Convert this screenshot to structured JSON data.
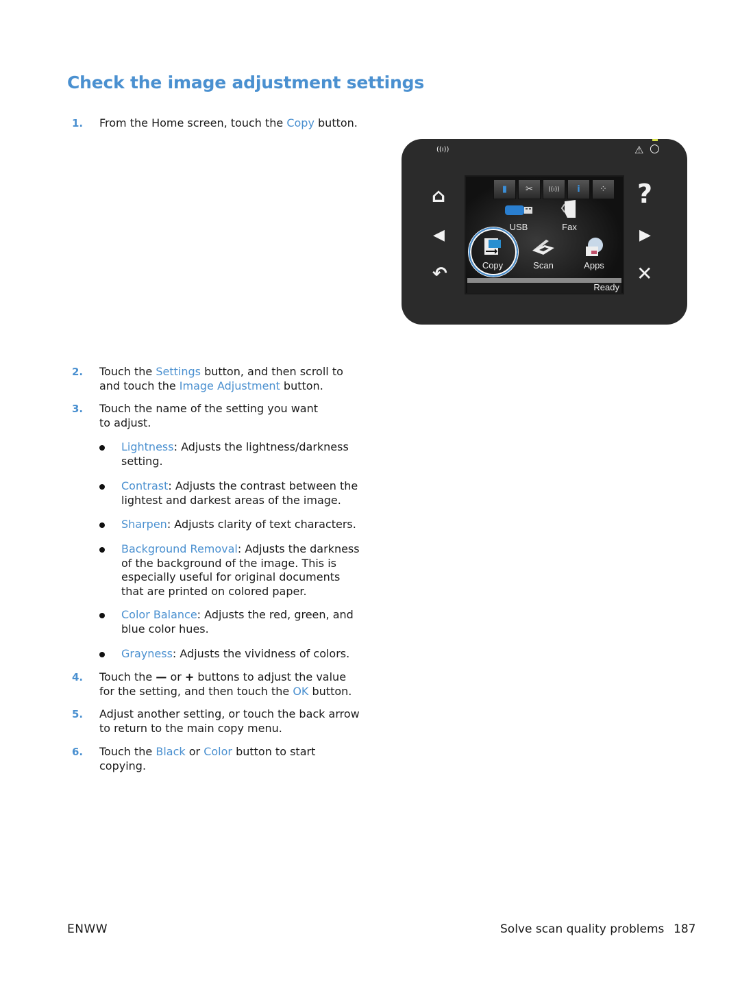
{
  "title": "Check the image adjustment settings",
  "steps": [
    {
      "num": "1.",
      "parts": [
        "From the Home screen, touch the ",
        "Copy",
        " button."
      ]
    },
    {
      "num": "2.",
      "parts": [
        "Touch the ",
        "Settings",
        " button, and then scroll to and touch the ",
        "Image Adjustment",
        " button."
      ]
    },
    {
      "num": "3.",
      "text": "Touch the name of the setting you want to adjust."
    },
    {
      "num": "4.",
      "parts": [
        "Touch the ",
        "—",
        " or ",
        "+",
        " buttons to adjust the value for the setting, and then touch the ",
        "OK",
        " button."
      ]
    },
    {
      "num": "5.",
      "text": "Adjust another setting, or touch the back arrow to return to the main copy menu."
    },
    {
      "num": "6.",
      "parts": [
        "Touch the ",
        "Black",
        " or ",
        "Color",
        " button to start copying."
      ]
    }
  ],
  "settings": [
    {
      "name": "Lightness",
      "desc": ": Adjusts the lightness/darkness setting."
    },
    {
      "name": "Contrast",
      "desc": ": Adjusts the contrast between the lightest and darkest areas of the image."
    },
    {
      "name": "Sharpen",
      "desc": ": Adjusts clarity of text characters."
    },
    {
      "name": "Background Removal",
      "desc": ": Adjusts the darkness of the background of the image. This is especially useful for original documents that are printed on colored paper."
    },
    {
      "name": "Color Balance",
      "desc": ": Adjusts the red, green, and blue color hues."
    },
    {
      "name": "Grayness",
      "desc": ": Adjusts the vividness of colors."
    }
  ],
  "panel": {
    "icons": {
      "wireless": "wireless-icon",
      "warning": "warning-icon",
      "power": "power-icon",
      "home": "home-icon",
      "left": "left-arrow-icon",
      "back": "back-icon",
      "help": "help-icon",
      "right": "right-arrow-icon",
      "cancel": "cancel-icon"
    },
    "glyphs": {
      "wireless": "((ı))",
      "warning": "⚠",
      "power": "○",
      "home": "⌂",
      "left": "◀",
      "back": "↶",
      "help": "?",
      "right": "▶",
      "cancel": "✕"
    },
    "topbar": [
      "▮",
      "✂",
      "((ı))",
      "i",
      "⁘"
    ],
    "apps": [
      "USB",
      "Fax",
      "Copy",
      "Scan",
      "Apps"
    ],
    "status": "Ready",
    "highlight_color": "#4a90d0"
  },
  "footer": {
    "left": "ENWW",
    "section": "Solve scan quality problems",
    "page": "187"
  },
  "colors": {
    "accent": "#4a90d0",
    "text": "#1a1a1a"
  }
}
